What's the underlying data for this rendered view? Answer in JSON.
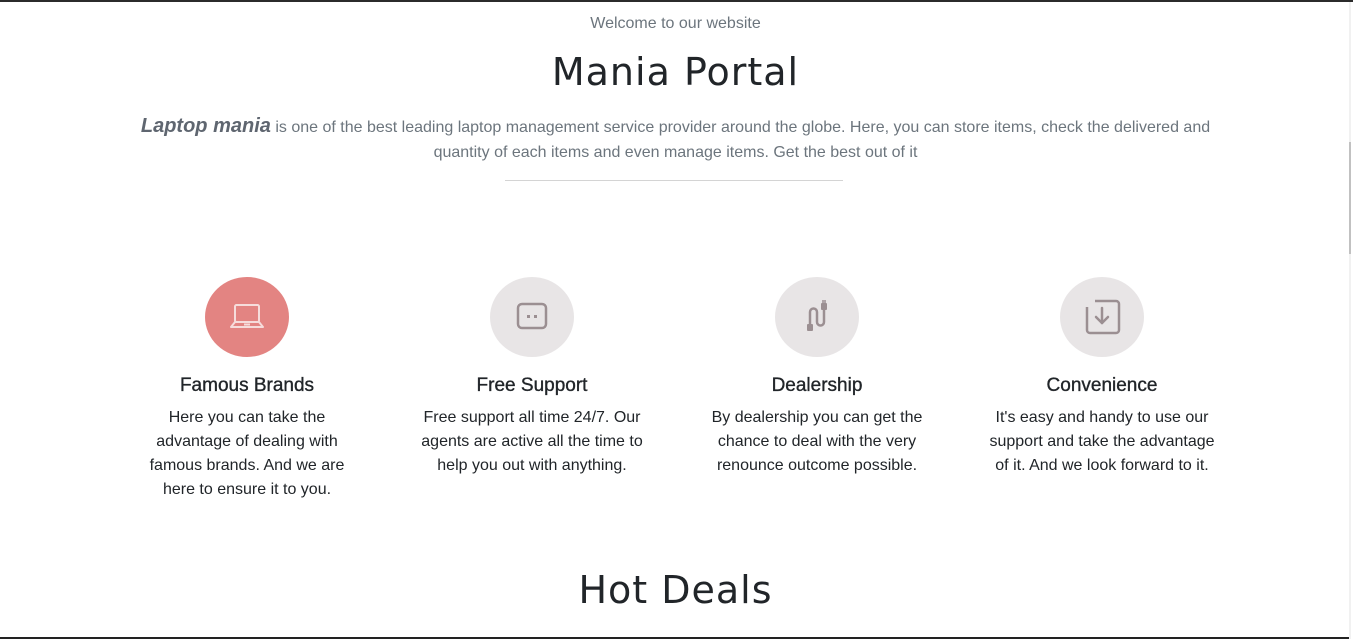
{
  "intro": {
    "welcome": "Welcome to our website",
    "title": "Mania Portal",
    "brand": "Laptop mania",
    "description": " is one of the best leading laptop management service provider around the globe. Here, you can store items, check the delivered and quantity of each items and even manage items. Get the best out of it"
  },
  "features": [
    {
      "icon": "laptop-icon",
      "title": "Famous Brands",
      "text": "Here you can take the advantage of dealing with famous brands. And we are here to ensure it to you."
    },
    {
      "icon": "chat-icon",
      "title": "Free Support",
      "text": "Free support all time 24/7. Our agents are active all the time to help you out with anything."
    },
    {
      "icon": "cable-icon",
      "title": "Dealership",
      "text": "By dealership you can get the chance to deal with the very renounce outcome possible."
    },
    {
      "icon": "download-box-icon",
      "title": "Convenience",
      "text": "It's easy and handy to use our support and take the advantage of it. And we look forward to it."
    }
  ],
  "deals": {
    "title": "Hot Deals"
  },
  "colors": {
    "accent": "#e38482",
    "icon_bg": "#e8e5e6",
    "icon_stroke": "#9b8f92",
    "text": "#212529",
    "muted": "#6c757d"
  }
}
